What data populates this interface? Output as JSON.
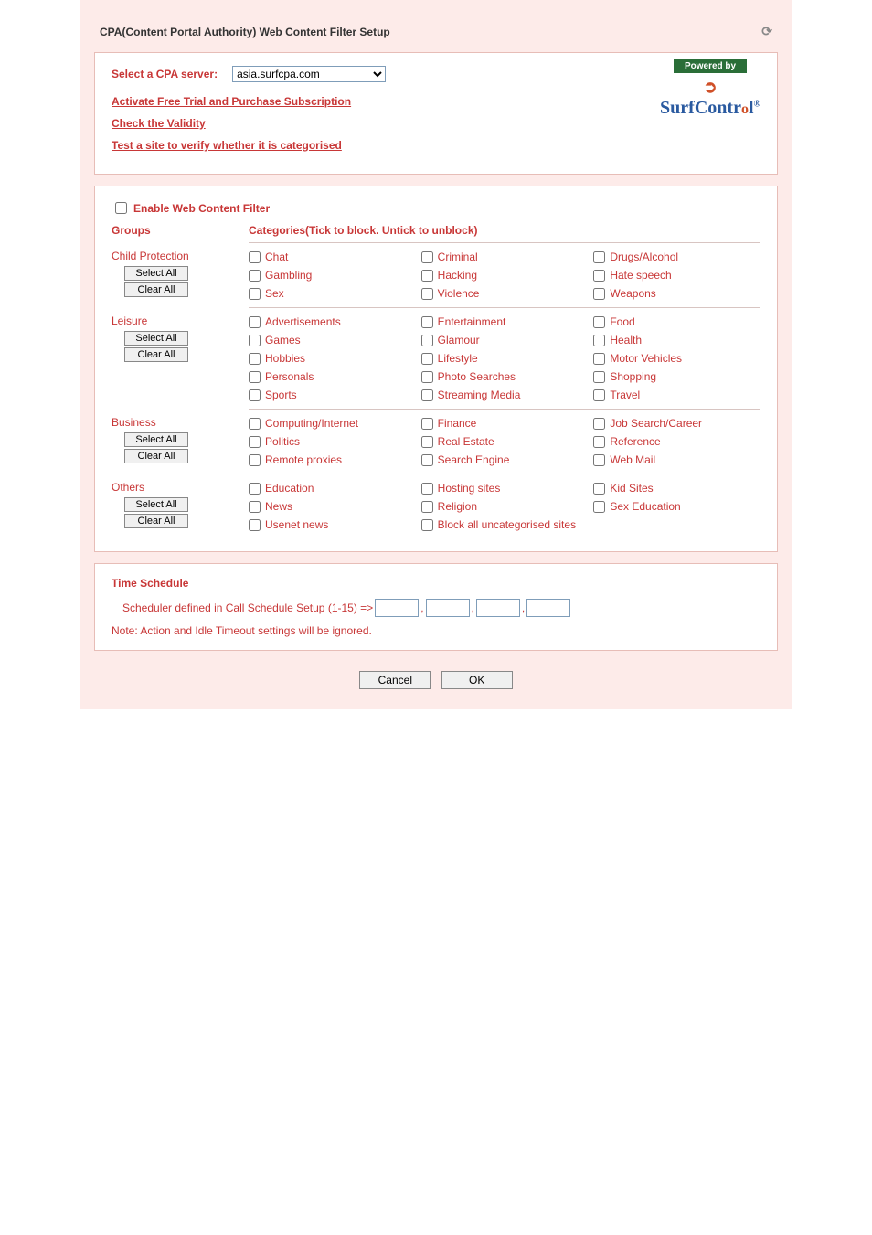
{
  "page": {
    "title": "CPA(Content Portal Authority) Web Content Filter Setup"
  },
  "server": {
    "label": "Select a CPA server:",
    "value": "asia.surfcpa.com"
  },
  "links": {
    "activate": "Activate Free Trial and Purchase Subscription",
    "check": "Check the Validity",
    "test": "Test a site to verify whether it is categorised"
  },
  "logo": {
    "powered_by": "Powered by",
    "brand1": "Surf",
    "brand2": "Contr",
    "brand3": "l"
  },
  "filter": {
    "enable_label": "Enable Web Content Filter",
    "groups_header": "Groups",
    "categories_header": "Categories(Tick to block. Untick to unblock)",
    "select_all": "Select All",
    "clear_all": "Clear  All",
    "groups": [
      {
        "name": "Child Protection",
        "cats": [
          "Chat",
          "Criminal",
          "Drugs/Alcohol",
          "Gambling",
          "Hacking",
          "Hate speech",
          "Sex",
          "Violence",
          "Weapons"
        ]
      },
      {
        "name": "Leisure",
        "cats": [
          "Advertisements",
          "Entertainment",
          "Food",
          "Games",
          "Glamour",
          "Health",
          "Hobbies",
          "Lifestyle",
          "Motor Vehicles",
          "Personals",
          "Photo Searches",
          "Shopping",
          "Sports",
          "Streaming Media",
          "Travel"
        ]
      },
      {
        "name": "Business",
        "cats": [
          "Computing/Internet",
          "Finance",
          "Job Search/Career",
          "Politics",
          "Real Estate",
          "Reference",
          "Remote proxies",
          "Search Engine",
          "Web Mail"
        ]
      },
      {
        "name": "Others",
        "cats": [
          "Education",
          "Hosting sites",
          "Kid Sites",
          "News",
          "Religion",
          "Sex Education",
          "Usenet news",
          "Block all uncategorised sites"
        ]
      }
    ]
  },
  "schedule": {
    "title": "Time Schedule",
    "label": "Scheduler defined in Call Schedule Setup (1-15) =>",
    "note": "Note: Action and Idle Timeout settings will be ignored."
  },
  "buttons": {
    "cancel": "Cancel",
    "ok": "OK"
  }
}
